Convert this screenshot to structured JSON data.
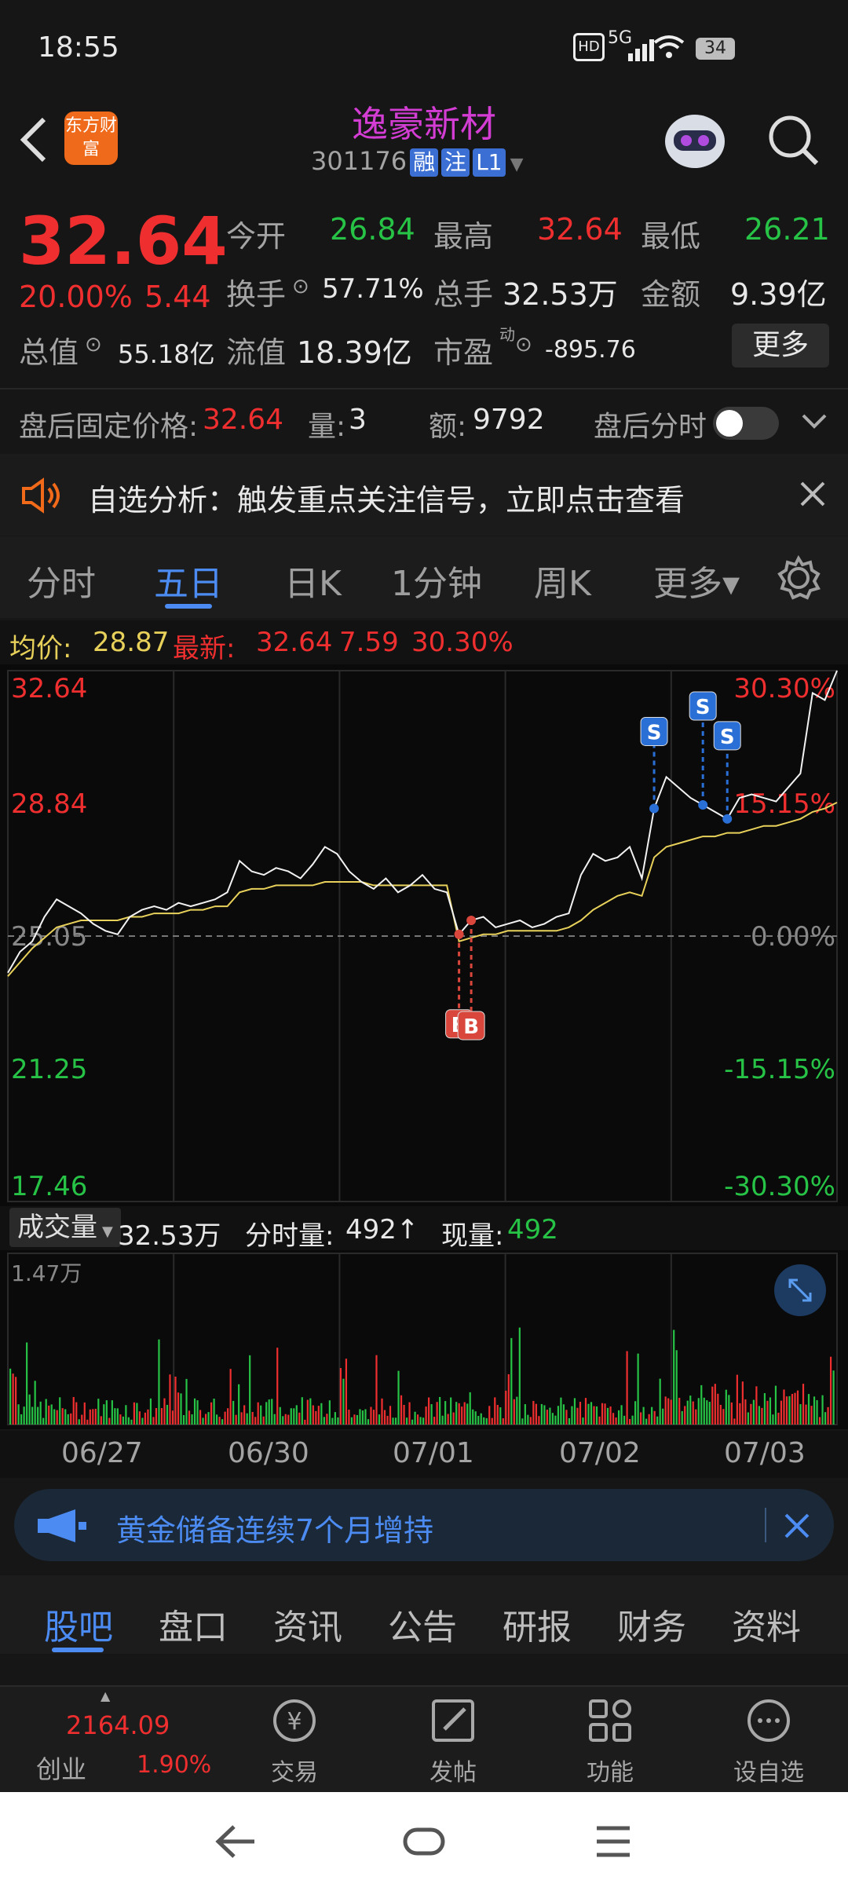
{
  "status": {
    "time": "18:55",
    "net": "5G",
    "battery": "34"
  },
  "header": {
    "brand": "东方财富",
    "title": "逸豪新材",
    "code": "301176",
    "badges": [
      "融",
      "注",
      "L1"
    ]
  },
  "quote": {
    "price": "32.64",
    "pct": "20.00%",
    "change": "5.44",
    "open_label": "今开",
    "open": "26.84",
    "high_label": "最高",
    "high": "32.64",
    "low_label": "最低",
    "low": "26.21",
    "turnover_label": "换手",
    "turnover": "57.71%",
    "volume_label": "总手",
    "volume": "32.53万",
    "amount_label": "金额",
    "amount": "9.39亿",
    "mktcap_label": "总值",
    "mktcap": "55.18亿",
    "float_label": "流值",
    "float": "18.39亿",
    "pe_label": "市盈",
    "pe_sup": "动",
    "pe": "-895.76",
    "more": "更多"
  },
  "after_hours": {
    "price_label": "盘后固定价格:",
    "price": "32.64",
    "vol_label": "量:",
    "vol": "3",
    "amt_label": "额:",
    "amt": "9792",
    "toggle_label": "盘后分时"
  },
  "notice": {
    "text": "自选分析：触发重点关注信号，立即点击查看"
  },
  "chart_tabs": [
    "分时",
    "五日",
    "日K",
    "1分钟",
    "周K",
    "更多▾"
  ],
  "chart_info": {
    "avg_label": "均价:",
    "avg": "28.87",
    "latest_label": "最新:",
    "latest": "32.64",
    "chg": "7.59",
    "pct": "30.30%"
  },
  "chart_data": {
    "type": "line",
    "x_dates": [
      "06/27",
      "06/30",
      "07/01",
      "07/02",
      "07/03"
    ],
    "y_ticks_left": [
      "32.64",
      "28.84",
      "25.05",
      "21.25",
      "17.46"
    ],
    "y_ticks_right": [
      "30.30%",
      "15.15%",
      "0.00%",
      "-15.15%",
      "-30.30%"
    ],
    "ylim": [
      17.46,
      32.64
    ],
    "base_price": 25.05,
    "price": [
      24.0,
      24.6,
      24.9,
      25.6,
      26.1,
      25.9,
      25.7,
      25.4,
      25.2,
      25.1,
      25.6,
      25.8,
      25.9,
      25.8,
      26.0,
      25.9,
      26.0,
      26.1,
      26.3,
      27.2,
      26.9,
      26.8,
      27.0,
      26.9,
      26.7,
      27.1,
      27.6,
      27.4,
      26.9,
      26.6,
      26.4,
      26.7,
      26.3,
      26.5,
      26.8,
      26.4,
      26.3,
      25.1,
      25.5,
      25.6,
      25.3,
      25.4,
      25.5,
      25.3,
      25.4,
      25.6,
      25.7,
      26.8,
      27.4,
      27.2,
      27.3,
      27.6,
      26.7,
      28.7,
      29.6,
      29.3,
      29.0,
      28.8,
      28.6,
      28.4,
      29.0,
      29.1,
      29.0,
      28.9,
      29.3,
      29.7,
      32.0,
      31.8,
      32.64
    ],
    "avg_price": [
      23.9,
      24.3,
      24.7,
      25.0,
      25.3,
      25.4,
      25.5,
      25.5,
      25.5,
      25.5,
      25.6,
      25.6,
      25.7,
      25.7,
      25.7,
      25.8,
      25.8,
      25.9,
      25.9,
      26.3,
      26.4,
      26.4,
      26.5,
      26.5,
      26.5,
      26.5,
      26.6,
      26.6,
      26.6,
      26.6,
      26.5,
      26.5,
      26.5,
      26.5,
      26.5,
      26.5,
      26.5,
      24.9,
      25.0,
      25.1,
      25.1,
      25.2,
      25.2,
      25.2,
      25.2,
      25.2,
      25.3,
      25.5,
      25.8,
      26.0,
      26.2,
      26.3,
      26.2,
      27.3,
      27.6,
      27.7,
      27.8,
      27.9,
      27.9,
      28.0,
      28.0,
      28.1,
      28.2,
      28.2,
      28.3,
      28.4,
      28.6,
      28.7,
      28.87
    ],
    "signals": [
      {
        "label": "B",
        "day": "07/02"
      },
      {
        "label": "B",
        "day": "07/02"
      },
      {
        "label": "S",
        "day": "07/03"
      },
      {
        "label": "S",
        "day": "07/03"
      },
      {
        "label": "S",
        "day": "07/03"
      }
    ]
  },
  "volume_info": {
    "label": "成交量",
    "total": "32.53万",
    "tick_label": "分时量:",
    "tick": "492↑",
    "now_label": "现量:",
    "now": "492",
    "ymax": "1.47万"
  },
  "banner": {
    "text": "黄金储备连续7个月增持"
  },
  "bottom_tabs": [
    "股吧",
    "盘口",
    "资讯",
    "公告",
    "研报",
    "财务",
    "资料"
  ],
  "footer": {
    "index_value": "2164.09",
    "index_name": "创业",
    "index_pct": "1.90%",
    "buttons": [
      "交易",
      "发帖",
      "功能",
      "设自选"
    ]
  },
  "colors": {
    "up": "#ef2f2f",
    "down": "#27c346",
    "accent": "#4c8cf2",
    "title": "#d43dd4",
    "avg_line": "#e8d15a"
  }
}
